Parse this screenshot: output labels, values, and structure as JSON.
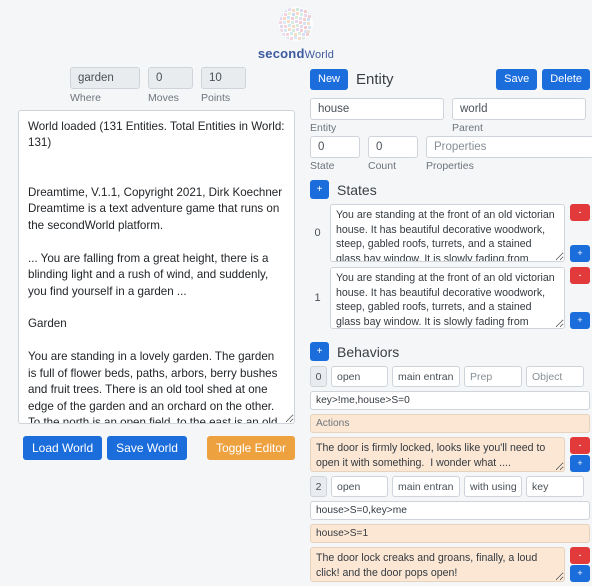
{
  "brand": {
    "logo_icon": "dotted-globe-icon",
    "name_bold": "second",
    "name_light": "World"
  },
  "status_bar": {
    "fields": [
      {
        "name": "where",
        "value": "garden",
        "label": "Where"
      },
      {
        "name": "moves",
        "value": "0",
        "label": "Moves"
      },
      {
        "name": "points",
        "value": "10",
        "label": "Points"
      }
    ]
  },
  "story": {
    "text": "World loaded (131 Entities. Total Entities in World: 131)\n\n\nDreamtime, V.1.1, Copyright 2021, Dirk Koechner\nDreamtime is a text adventure game that runs on the secondWorld platform.\n\n... You are falling from a great height, there is a blinding light and a rush of wind, and suddenly, you find yourself in a garden ...\n\nGarden\n\nYou are standing in a lovely garden. The garden is full of flower beds, paths, arbors, berry bushes and fruit trees. There is an old tool shed at one edge of the garden and an orchard on the other. To the north is an open field, to the east is an old victorian house. To the south is the old town road leading into the village."
  },
  "actions_bar": {
    "load_world": "Load World",
    "save_world": "Save World",
    "toggle_editor": "Toggle Editor"
  },
  "editor": {
    "header": {
      "new_label": "New",
      "title": "Entity",
      "save_label": "Save",
      "delete_label": "Delete"
    },
    "entity": {
      "name_value": "house",
      "name_label": "Entity",
      "parent_value": "world",
      "parent_label": "Parent",
      "state_value": "0",
      "state_label": "State",
      "count_value": "0",
      "count_label": "Count",
      "properties_value": "",
      "properties_placeholder": "Properties",
      "properties_label": "Properties"
    },
    "states": {
      "add_label": "+",
      "title": "States",
      "items": [
        {
          "index": "0",
          "text": "You are standing at the front of an old victorian house. It has beautiful decorative woodwork, steep, gabled roofs, turrets, and a stained glass bay window. It is slowly fading from disrepair.  Here is the main entrance door.",
          "remove_label": "-",
          "add_label": "+"
        },
        {
          "index": "1",
          "text": "You are standing at the front of an old victorian house. It has beautiful decorative woodwork, steep, gabled roofs, turrets, and a stained glass bay window. It is slowly fading from disrepair.  The main entrance door has been unlocked and is slightly open...",
          "remove_label": "-",
          "add_label": "+"
        }
      ]
    },
    "behaviors": {
      "add_label": "+",
      "title": "Behaviors",
      "items": [
        {
          "index": "0",
          "verb": "open",
          "target": "main entranc",
          "prep_value": "",
          "prep_placeholder": "Prep",
          "object_value": "",
          "object_placeholder": "Object",
          "condition": "key>!me,house>S=0",
          "actions_value": "",
          "actions_placeholder": "Actions",
          "response": "The door is firmly locked, looks like you'll need to open it with something.  I wonder what ....",
          "remove_label": "-",
          "add_label": "+"
        },
        {
          "index": "2",
          "verb": "open",
          "target": "main entranc",
          "prep_value": "with using",
          "prep_placeholder": "Prep",
          "object_value": "key",
          "object_placeholder": "Object",
          "condition": "house>S=0,key>me",
          "actions_value": "house>S=1",
          "actions_placeholder": "Actions",
          "response": "The door lock creaks and groans, finally, a loud click! and the door pops open!",
          "remove_label": "-",
          "add_label": "+"
        }
      ]
    }
  },
  "colors": {
    "primary": "#1b6ddc",
    "danger": "#e23a3a",
    "warn": "#eda13f",
    "brand_text": "#3d5a9e",
    "page_bg": "#f5f6f8",
    "action_bg": "#fbe7d4"
  }
}
